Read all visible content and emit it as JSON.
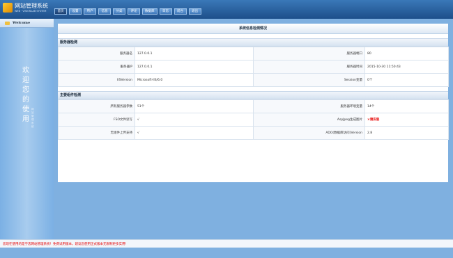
{
  "header": {
    "title": "网站管理系统",
    "subtitle": "WEB · VISIONLAB SYSTEM",
    "nav": [
      "首页",
      "设置",
      "用户",
      "信息",
      "分类",
      "评论",
      "数据库",
      "日志",
      "前台",
      "退出"
    ]
  },
  "sidebar": {
    "welcome": "Welcome",
    "welcome_text": "欢迎您的使用",
    "welcome_small": "网站管理系统"
  },
  "panel": {
    "title": "系统信息检测情况",
    "server_section": "服务器检测",
    "server_rows": [
      {
        "l1": "服务器名",
        "v1": "127.0.0.1",
        "l2": "服务器端口",
        "v2": "80"
      },
      {
        "l1": "服务器IP",
        "v1": "127.0.0.1",
        "l2": "服务器时间",
        "v2": "2015-10-30 11:50:43"
      },
      {
        "l1": "IISVersion",
        "v1": "Microsoft-IIS/6.0",
        "l2": "Session变量",
        "v2": "0个"
      }
    ],
    "component_section": "主要组件检测",
    "component_rows": [
      {
        "l1": "所有服务器参数",
        "v1": "51个",
        "l2": "服务器环境变量",
        "v2": "14个"
      },
      {
        "l1": "FSO文件读写",
        "v1": "√",
        "l2": "AspJpeg生成图片",
        "v2": "×请安装"
      },
      {
        "l1": "无组件上传支持",
        "v1": "√",
        "l2": "ADO(数据库访问)Version",
        "v2": "2.8"
      }
    ]
  },
  "footer": {
    "text": "您现在使用的是宁志网站管理系统！免费试用版本，建议您使用正式版本无限制更多实用！"
  },
  "colors": {
    "header": "#1d4f8a",
    "main_bg": "#7fb0e0",
    "warning": "#e60000"
  }
}
